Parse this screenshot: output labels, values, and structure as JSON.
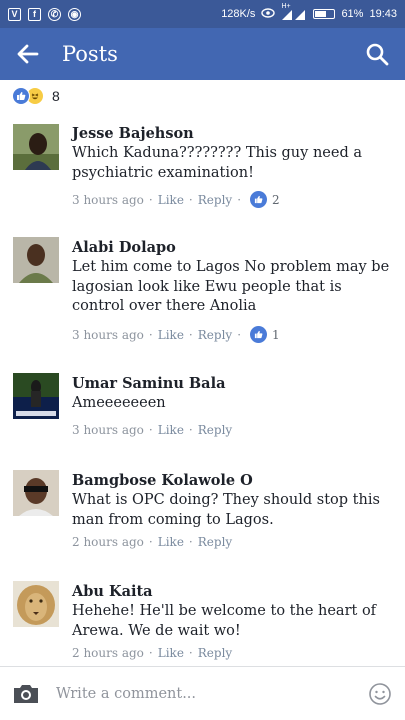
{
  "status_bar": {
    "speed": "128K/s",
    "network": "H+",
    "battery": "61%",
    "battery_level": 0.61,
    "time": "19:43"
  },
  "header": {
    "title": "Posts",
    "back_icon": "arrow-left-icon",
    "search_icon": "search-icon",
    "bg_color": "#4267b2"
  },
  "reactions": {
    "types": [
      "like",
      "haha"
    ],
    "count": "8"
  },
  "comments": [
    {
      "name": "Jesse Bajehson",
      "text": "Which Kaduna???????? This guy need a psychiatric examination!",
      "time": "3 hours ago",
      "like_label": "Like",
      "reply_label": "Reply",
      "likes": "2"
    },
    {
      "name": "Alabi Dolapo",
      "text": "Let him come to Lagos No problem may be lagosian look like Ewu people that is control over there Anolia",
      "time": "3 hours ago",
      "like_label": "Like",
      "reply_label": "Reply",
      "likes": "1"
    },
    {
      "name": "Umar Saminu Bala",
      "text": "Ameeeeeeen",
      "time": "3 hours ago",
      "like_label": "Like",
      "reply_label": "Reply"
    },
    {
      "name": "Bamgbose Kolawole O",
      "text": "What is OPC doing? They should stop this man from coming to Lagos.",
      "time": "2 hours ago",
      "like_label": "Like",
      "reply_label": "Reply"
    },
    {
      "name": "Abu Kaita",
      "text": "Hehehe! He'll be welcome to the heart of Arewa. We de wait wo!",
      "time": "2 hours ago",
      "like_label": "Like",
      "reply_label": "Reply"
    }
  ],
  "composer": {
    "placeholder": "Write a comment...",
    "camera_icon": "camera-icon",
    "emoji_icon": "emoji-icon"
  }
}
